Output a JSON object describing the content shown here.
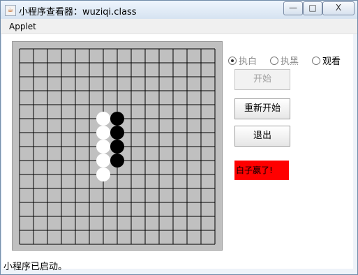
{
  "window": {
    "title": "小程序查看器：wuziqi.class",
    "minimize": "—",
    "maximize": "□",
    "close": "X"
  },
  "menu": {
    "items": [
      "Applet"
    ]
  },
  "game": {
    "radio_options": [
      {
        "label": "执白",
        "checked": true
      },
      {
        "label": "执黑",
        "checked": false
      },
      {
        "label": "观看",
        "checked": false
      }
    ],
    "buttons": {
      "start": "开始",
      "restart": "重新开始",
      "exit": "退出"
    },
    "result": "白子赢了!",
    "result_color": "#ff0000",
    "board": {
      "size": 15,
      "white_stones": [
        [
          6,
          5
        ],
        [
          6,
          6
        ],
        [
          6,
          7
        ],
        [
          6,
          8
        ],
        [
          6,
          9
        ]
      ],
      "black_stones": [
        [
          7,
          5
        ],
        [
          7,
          6
        ],
        [
          7,
          7
        ],
        [
          7,
          8
        ]
      ]
    }
  },
  "status": "小程序已启动。"
}
